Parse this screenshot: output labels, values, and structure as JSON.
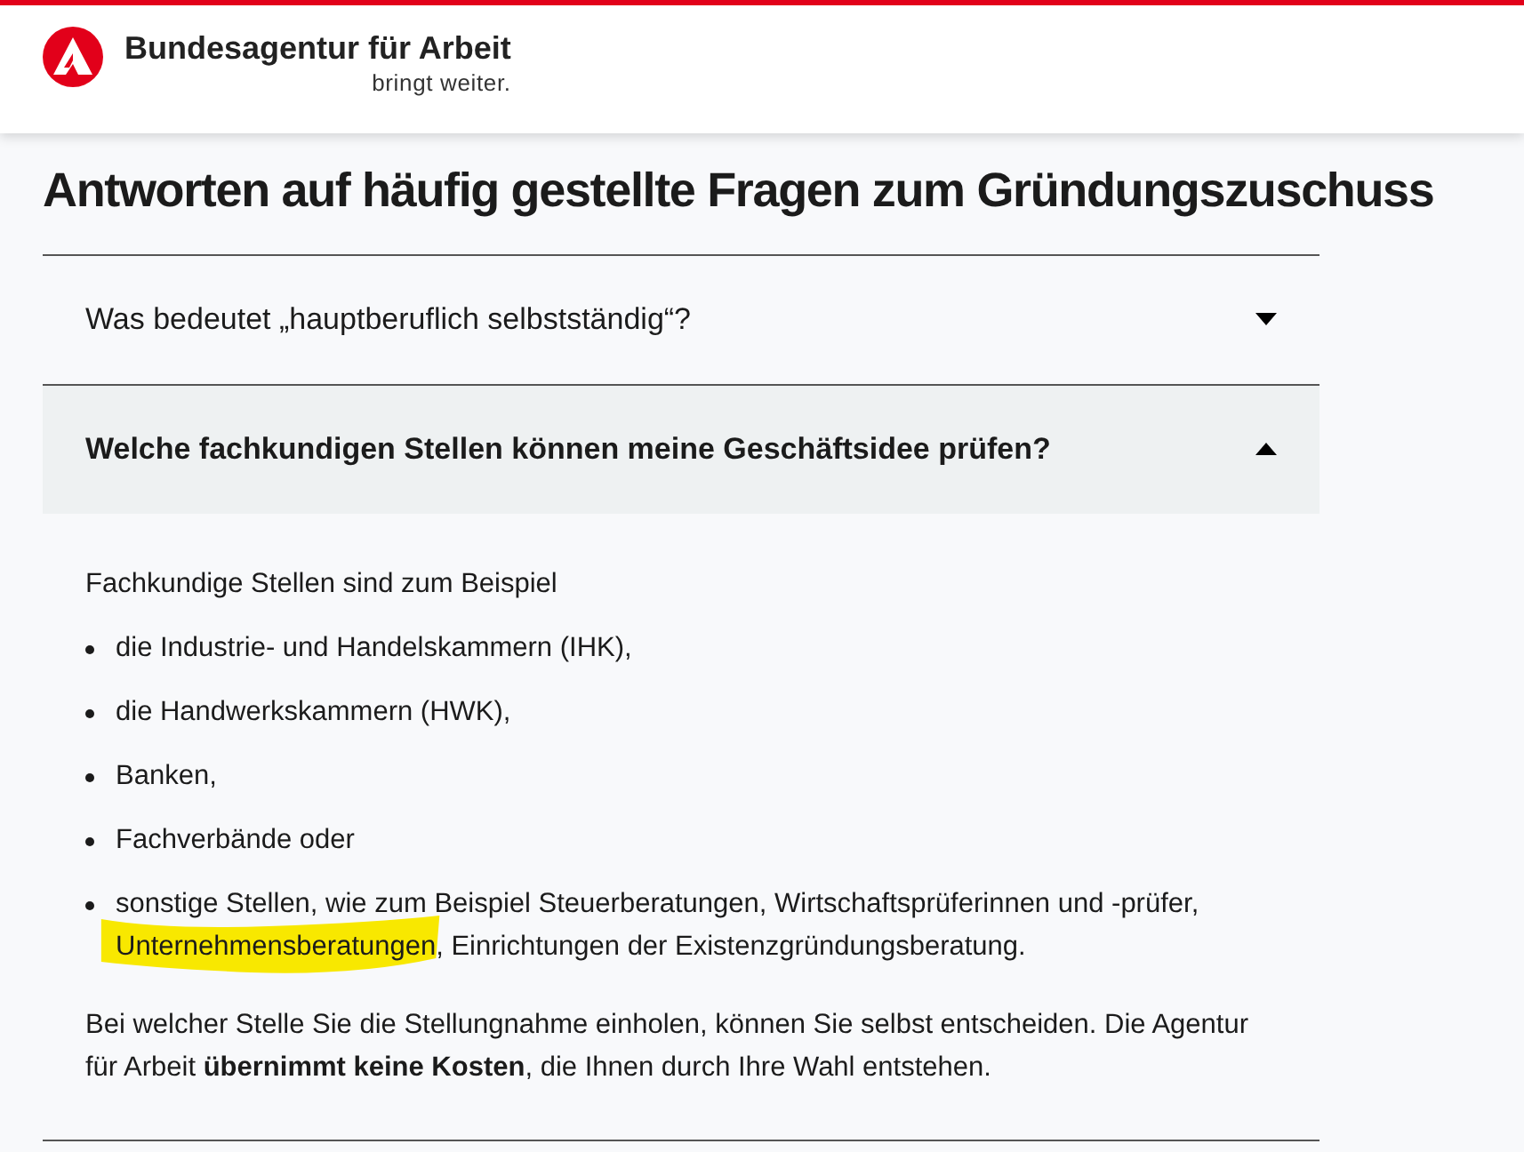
{
  "header": {
    "brand": "Bundesagentur für Arbeit",
    "tagline": "bringt weiter."
  },
  "page_title": "Antworten auf häufig gestellte Fragen zum Gründungszuschuss",
  "faq": [
    {
      "question": "Was bedeutet „hauptberuflich selbstständig“?",
      "expanded": false
    },
    {
      "question": "Welche fachkundigen Stellen können meine Geschäftsidee prüfen?",
      "expanded": true,
      "answer": {
        "intro": "Fachkundige Stellen sind zum Beispiel",
        "list": [
          {
            "parts": [
              {
                "text": "die Industrie- und Handelskammern (IHK),",
                "highlighted": false
              }
            ]
          },
          {
            "parts": [
              {
                "text": "die Handwerkskammern (HWK),",
                "highlighted": false
              }
            ]
          },
          {
            "parts": [
              {
                "text": "Banken,",
                "highlighted": false
              }
            ]
          },
          {
            "parts": [
              {
                "text": "Fachverbände oder",
                "highlighted": false
              }
            ]
          },
          {
            "parts": [
              {
                "text": "sonstige Stellen, wie zum Beispiel Steuerberatungen, Wirtschaftsprüferinnen und -prüfer, ",
                "highlighted": false
              },
              {
                "text": "Unternehmensberatungen",
                "highlighted": true
              },
              {
                "text": ", Einrichtungen der Existenzgründungsberatung.",
                "highlighted": false
              }
            ]
          }
        ],
        "closing": "Bei welcher Stelle Sie die Stellungnahme einholen, können Sie selbst entscheiden. Die Agentur für Arbeit **übernimmt keine Kosten**, die Ihnen durch Ihre Wahl entstehen."
      }
    }
  ]
}
